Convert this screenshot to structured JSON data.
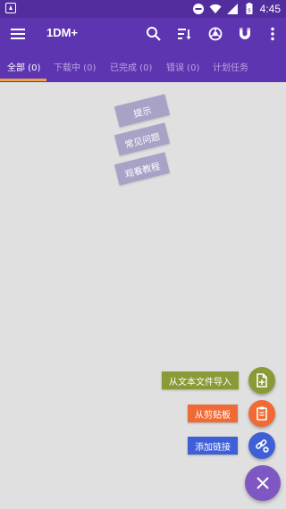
{
  "status_bar": {
    "time": "4:45",
    "icons": [
      "launcher-a-icon",
      "minus-circle-icon",
      "wifi-icon",
      "signal-icon",
      "battery-icon"
    ]
  },
  "toolbar": {
    "title": "1DM+",
    "icons": [
      "menu-icon",
      "search-icon",
      "sort-icon",
      "browser-icon",
      "magnet-icon",
      "more-vert-icon"
    ]
  },
  "tabs": [
    {
      "label": "全部 (0)",
      "active": true
    },
    {
      "label": "下载中 (0)",
      "active": false
    },
    {
      "label": "已完成 (0)",
      "active": false
    },
    {
      "label": "错误 (0)",
      "active": false
    },
    {
      "label": "计划任务",
      "active": false
    }
  ],
  "hints": [
    "提示",
    "常见问题",
    "观看教程"
  ],
  "fab_actions": [
    {
      "label": "从文本文件导入",
      "color": "#8a9a36",
      "icon": "file-import-icon"
    },
    {
      "label": "从剪贴板",
      "color": "#f06a35",
      "icon": "clipboard-icon"
    },
    {
      "label": "添加链接",
      "color": "#3f5fd6",
      "icon": "link-add-icon"
    }
  ],
  "fab_main": {
    "icon": "close-icon",
    "color": "#7e57c2"
  },
  "colors": {
    "toolbar": "#5e35b1",
    "status_bar": "#522d9e",
    "tab_indicator": "#f0a24a",
    "background": "#e0e0e0"
  }
}
